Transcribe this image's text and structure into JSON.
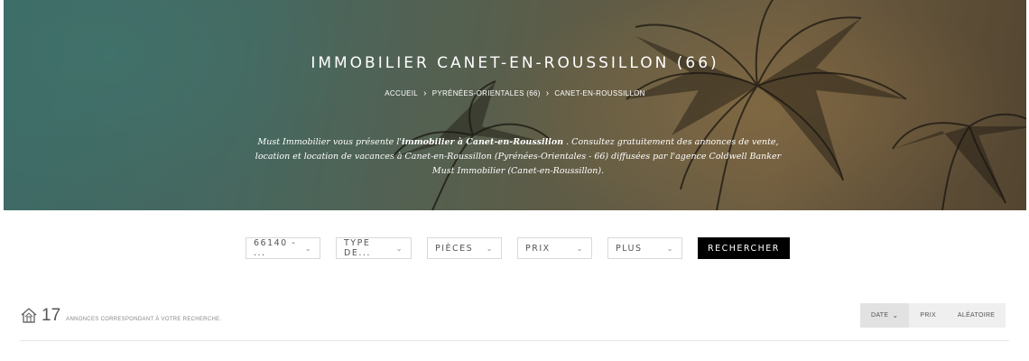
{
  "hero": {
    "title": "IMMOBILIER CANET-EN-ROUSSILLON (66)",
    "breadcrumb": [
      "ACCUEIL",
      "PYRÉNÉES-ORIENTALES (66)",
      "CANET-EN-ROUSSILLON"
    ],
    "breadcrumb_separator": "›",
    "description": {
      "part1": "Must Immobilier vous présente l'",
      "bold": "immobilier à Canet-en-Roussillon",
      "part2": " . Consultez gratuitement des annonces de vente, location et location de vacances à Canet-en-Roussillon (Pyrénées-Orientales - 66) diffusées par l'agence Coldwell Banker Must Immobilier (Canet-en-Roussillon)."
    }
  },
  "search": {
    "filters": [
      {
        "value": "66140 - ...",
        "icon": "chevron-down-icon"
      },
      {
        "value": "TYPE DE...",
        "icon": "chevron-down-icon"
      },
      {
        "value": "PIÈCES",
        "icon": "chevron-down-icon"
      },
      {
        "value": "PRIX",
        "icon": "chevron-down-icon"
      },
      {
        "value": "PLUS",
        "icon": "chevron-down-icon"
      }
    ],
    "submit_label": "RECHERCHER"
  },
  "results": {
    "count": "17",
    "label": "ANNONCES CORRESPONDANT À VOTRE RECHERCHE.",
    "icon": "house-icon"
  },
  "sort": {
    "options": [
      "DATE",
      "PRIX",
      "ALÉATOIRE"
    ],
    "active": "DATE"
  },
  "colors": {
    "button_bg": "#000000",
    "sort_bg": "#efefef"
  }
}
